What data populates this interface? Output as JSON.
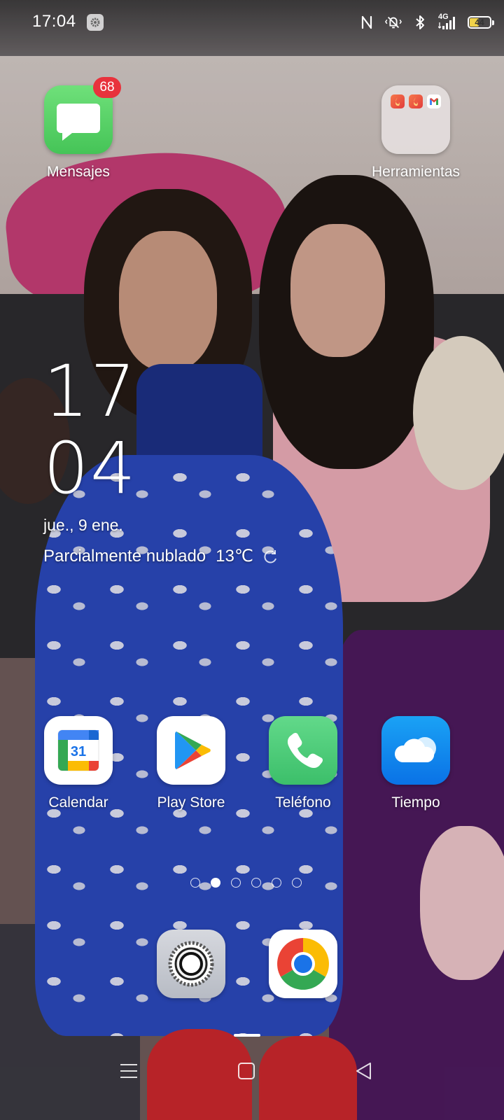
{
  "status_bar": {
    "time": "17:04",
    "network": "4G",
    "battery_percent": "44",
    "battery_level": 0.44,
    "icons": [
      "nfc-icon",
      "vibrate-silent-icon",
      "bluetooth-icon",
      "signal-icon",
      "battery-icon"
    ]
  },
  "apps_top": {
    "messages": {
      "label": "Mensajes",
      "badge": "68",
      "color": "#5cd164",
      "icon": "message-bubble-icon"
    },
    "tools_folder": {
      "label": "Herramientas",
      "icon": "folder-icon",
      "contents": [
        "flash-app-icon",
        "flash-app-icon",
        "gmail-icon"
      ]
    }
  },
  "clock_widget": {
    "hour": "17",
    "minute": "04",
    "date": "jue., 9 ene.",
    "weather": "Parcialmente nublado",
    "temperature": "13℃",
    "refresh_icon": "refresh-icon"
  },
  "apps_row": [
    {
      "label": "Calendar",
      "icon": "google-calendar-icon",
      "day": "31"
    },
    {
      "label": "Play Store",
      "icon": "play-store-icon"
    },
    {
      "label": "Teléfono",
      "icon": "phone-icon",
      "color": "#4ecb71"
    },
    {
      "label": "Tiempo",
      "icon": "weather-cloud-icon",
      "color": "#1c8ff0"
    }
  ],
  "page_indicator": {
    "pages": 6,
    "current": 2
  },
  "dock": [
    {
      "name": "settings",
      "icon": "settings-gear-icon"
    },
    {
      "name": "chrome",
      "icon": "chrome-icon"
    }
  ],
  "nav_bar": [
    "menu-icon",
    "home-icon",
    "back-icon"
  ]
}
